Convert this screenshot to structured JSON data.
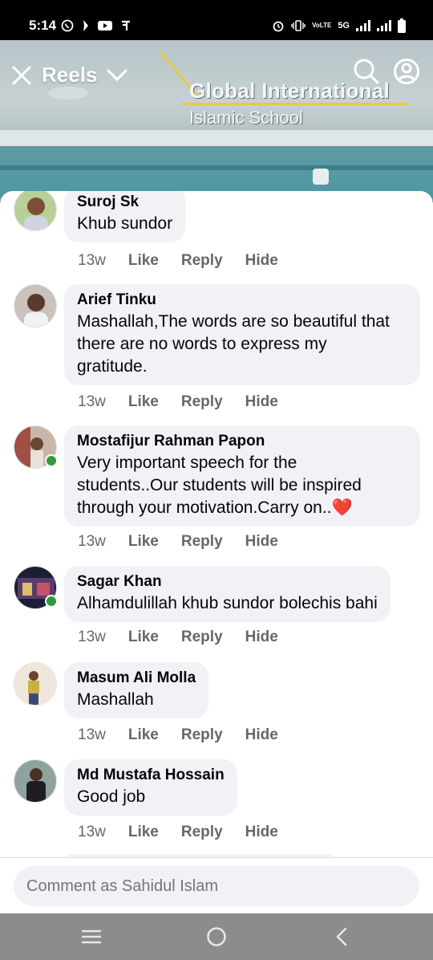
{
  "status": {
    "time": "5:14",
    "network": "5G"
  },
  "header": {
    "title": "Reels"
  },
  "reel": {
    "brand_title": "Global International",
    "brand_subtitle": "Islamic School"
  },
  "comments": [
    {
      "name": "Suroj Sk",
      "text": "Khub sundor",
      "time": "13w",
      "like": "Like",
      "reply": "Reply",
      "hide": "Hide"
    },
    {
      "name": "Arief Tinku",
      "text_lines": [
        "Mashallah,The words are so beautiful that",
        "there are no words to express my",
        "gratitude."
      ],
      "time": "13w",
      "like": "Like",
      "reply": "Reply",
      "hide": "Hide"
    },
    {
      "name": "Mostafijur Rahman Papon",
      "text_lines": [
        "Very important speech for the",
        "students..Our students will be inspired",
        "through your motivation.Carry on..❤️"
      ],
      "time": "13w",
      "like": "Like",
      "reply": "Reply",
      "hide": "Hide"
    },
    {
      "name": "Sagar Khan",
      "text": "Alhamdulillah khub sundor bolechis bahi",
      "time": "13w",
      "like": "Like",
      "reply": "Reply",
      "hide": "Hide"
    },
    {
      "name": "Masum Ali Molla",
      "text": "Mashallah",
      "time": "13w",
      "like": "Like",
      "reply": "Reply",
      "hide": "Hide"
    },
    {
      "name": "Md Mustafa Hossain",
      "text": "Good job",
      "time": "13w",
      "like": "Like",
      "reply": "Reply",
      "hide": "Hide"
    }
  ],
  "composer": {
    "placeholder": "Comment as Sahidul Islam"
  },
  "colors": {
    "online": "#2f9a3a",
    "bubble": "#f0f2f5",
    "meta": "#65676b"
  }
}
